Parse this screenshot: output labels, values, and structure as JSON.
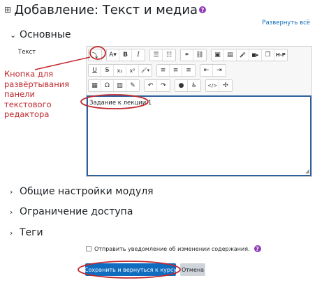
{
  "page": {
    "title": "Добавление: Текст и медиа"
  },
  "expand_all": "Развернуть всё",
  "sections": {
    "general": "Основные",
    "common_settings": "Общие настройки модуля",
    "restrict_access": "Ограничение доступа",
    "tags": "Теги"
  },
  "field": {
    "label": "Текст"
  },
  "annotation": {
    "text": "Кнопка для развёртывания панели текстового редактора"
  },
  "toolbar": {
    "row1": [
      {
        "name": "toolbar-toggle-button",
        "icon": "expand-toolbar-icon",
        "glyph": "⤵"
      },
      {
        "name": "font-style-button",
        "icon": "font-style-icon",
        "glyph": "A▾"
      },
      {
        "name": "bold-button",
        "icon": "bold-icon",
        "glyph": "B"
      },
      {
        "name": "italic-button",
        "icon": "italic-icon",
        "glyph": "I"
      },
      {
        "name": "unordered-list-button",
        "icon": "unordered-list-icon",
        "glyph": "☰"
      },
      {
        "name": "ordered-list-button",
        "icon": "ordered-list-icon",
        "glyph": "☷"
      },
      {
        "name": "link-button",
        "icon": "link-icon",
        "glyph": "⚭"
      },
      {
        "name": "unlink-button",
        "icon": "unlink-icon",
        "glyph": "⛓"
      },
      {
        "name": "image-button",
        "icon": "image-icon",
        "glyph": "▣"
      },
      {
        "name": "media-button",
        "icon": "media-file-icon",
        "glyph": "▤"
      },
      {
        "name": "record-audio-button",
        "icon": "microphone-icon",
        "glyph": "🎤"
      },
      {
        "name": "record-video-button",
        "icon": "video-camera-icon",
        "glyph": "■▸"
      },
      {
        "name": "manage-files-button",
        "icon": "files-icon",
        "glyph": "❐"
      },
      {
        "name": "h5p-button",
        "icon": "h5p-icon",
        "glyph": "H-P"
      }
    ],
    "row2": [
      {
        "name": "underline-button",
        "icon": "underline-icon",
        "glyph": "U"
      },
      {
        "name": "strikethrough-button",
        "icon": "strikethrough-icon",
        "glyph": "S"
      },
      {
        "name": "subscript-button",
        "icon": "subscript-icon",
        "glyph": "x₂"
      },
      {
        "name": "superscript-button",
        "icon": "superscript-icon",
        "glyph": "x²"
      },
      {
        "name": "text-color-button",
        "icon": "brush-icon",
        "glyph": "🖌▾"
      },
      {
        "name": "align-left-button",
        "icon": "align-left-icon",
        "glyph": "≡"
      },
      {
        "name": "align-center-button",
        "icon": "align-center-icon",
        "glyph": "≡"
      },
      {
        "name": "align-right-button",
        "icon": "align-right-icon",
        "glyph": "≡"
      },
      {
        "name": "outdent-button",
        "icon": "outdent-icon",
        "glyph": "⇤"
      },
      {
        "name": "indent-button",
        "icon": "indent-icon",
        "glyph": "⇥"
      }
    ],
    "row3": [
      {
        "name": "equation-button",
        "icon": "equation-icon",
        "glyph": "▦"
      },
      {
        "name": "special-chars-button",
        "icon": "special-chars-icon",
        "glyph": "Ω"
      },
      {
        "name": "table-button",
        "icon": "table-icon",
        "glyph": "▥"
      },
      {
        "name": "clear-formatting-button",
        "icon": "clear-formatting-icon",
        "glyph": "✎"
      },
      {
        "name": "undo-button",
        "icon": "undo-icon",
        "glyph": "↶"
      },
      {
        "name": "redo-button",
        "icon": "redo-icon",
        "glyph": "↷"
      },
      {
        "name": "accessibility-checker-button",
        "icon": "accessibility-icon",
        "glyph": "●"
      },
      {
        "name": "screenreader-helper-button",
        "icon": "screenreader-icon",
        "glyph": "♿"
      },
      {
        "name": "html-button",
        "icon": "code-icon",
        "glyph": "</>"
      },
      {
        "name": "fullscreen-button",
        "icon": "fullscreen-icon",
        "glyph": "✣"
      }
    ]
  },
  "editor": {
    "content": "Задание к лекции 1"
  },
  "notify": {
    "label": "Отправить уведомление об изменении содержания."
  },
  "buttons": {
    "save_return": "Сохранить и вернуться к курсу",
    "cancel": "Отмена"
  },
  "colors": {
    "accent": "#0f6cbf",
    "annotation": "#c0282e",
    "help": "#8f3ab7"
  }
}
